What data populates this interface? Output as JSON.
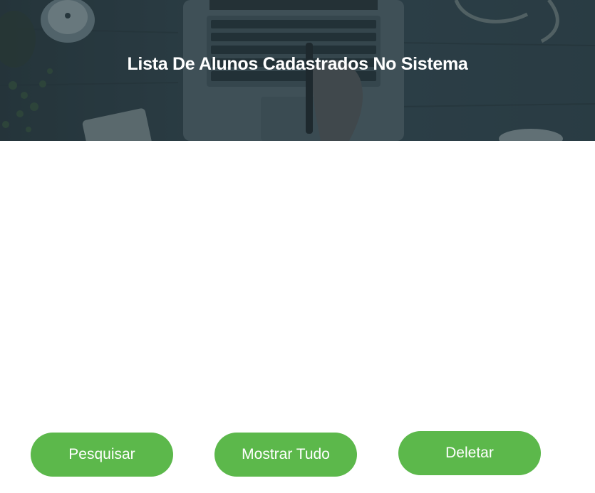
{
  "header": {
    "title": "Lista De Alunos Cadastrados No Sistema"
  },
  "actions": {
    "search_label": "Pesquisar",
    "show_all_label": "Mostrar Tudo",
    "delete_label": "Deletar"
  },
  "colors": {
    "button_green": "#5cb84b",
    "banner_overlay": "#33464f",
    "text_white": "#ffffff"
  }
}
